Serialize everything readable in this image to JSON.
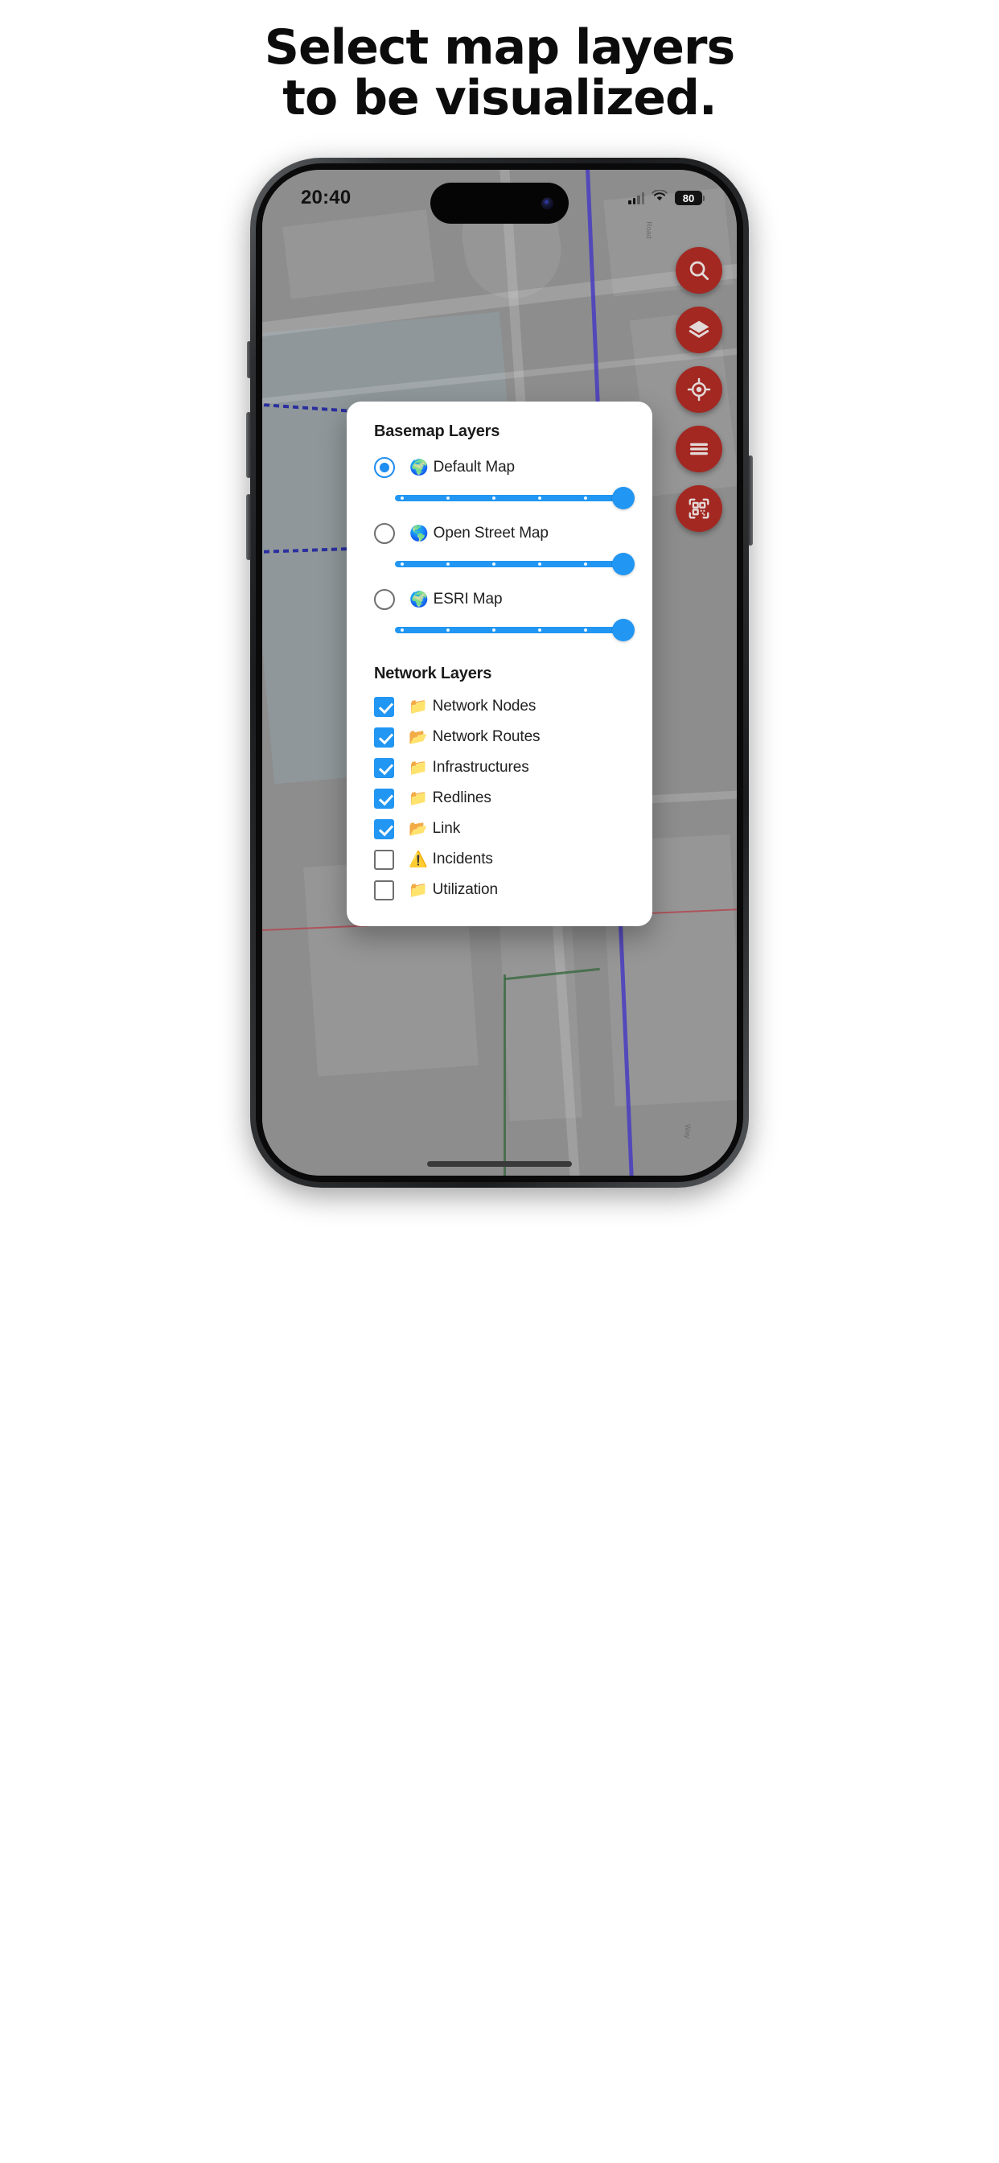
{
  "promo": {
    "line1": "Select map layers",
    "line2": "to be visualized."
  },
  "status_bar": {
    "time": "20:40",
    "battery": "80",
    "signal_icon": "cellular-signal-icon",
    "wifi_icon": "wifi-icon",
    "battery_icon": "battery-icon"
  },
  "map_toolbar": {
    "buttons": [
      {
        "name": "search-fab",
        "icon": "search-icon"
      },
      {
        "name": "layers-fab",
        "icon": "layers-icon"
      },
      {
        "name": "locate-fab",
        "icon": "crosshair-icon"
      },
      {
        "name": "menu-fab",
        "icon": "hamburger-menu-icon"
      },
      {
        "name": "qr-scan-fab",
        "icon": "qr-code-scan-icon"
      }
    ],
    "color": "#a32822"
  },
  "dialog": {
    "basemap": {
      "title": "Basemap Layers",
      "options": [
        {
          "label": "Default Map",
          "emoji": "🌍",
          "icon": "globe-green-icon",
          "selected": true,
          "opacity": 100
        },
        {
          "label": "Open Street Map",
          "emoji": "🌎",
          "icon": "globe-blue-icon",
          "selected": false,
          "opacity": 100
        },
        {
          "label": "ESRI Map",
          "emoji": "🌍",
          "icon": "globe-orange-icon",
          "selected": false,
          "opacity": 100
        }
      ]
    },
    "network": {
      "title": "Network Layers",
      "items": [
        {
          "label": "Network Nodes",
          "emoji": "📁",
          "icon": "folder-blue-icon",
          "checked": true
        },
        {
          "label": "Network Routes",
          "emoji": "📂",
          "icon": "folder-orange-icon",
          "checked": true
        },
        {
          "label": "Infrastructures",
          "emoji": "📁",
          "icon": "folder-green-icon",
          "checked": true
        },
        {
          "label": "Redlines",
          "emoji": "📁",
          "icon": "folder-red-icon",
          "checked": true
        },
        {
          "label": "Link",
          "emoji": "📂",
          "icon": "folder-red-open-icon",
          "checked": true
        },
        {
          "label": "Incidents",
          "emoji": "⚠️",
          "icon": "warning-triangle-icon",
          "checked": false
        },
        {
          "label": "Utilization",
          "emoji": "📁",
          "icon": "folder-magenta-icon",
          "checked": false
        }
      ]
    }
  },
  "colors": {
    "accent_blue": "#2196f3",
    "fab_red": "#a32822",
    "map_gray": "#8d8d8d",
    "dialog_bg": "#ffffff"
  }
}
